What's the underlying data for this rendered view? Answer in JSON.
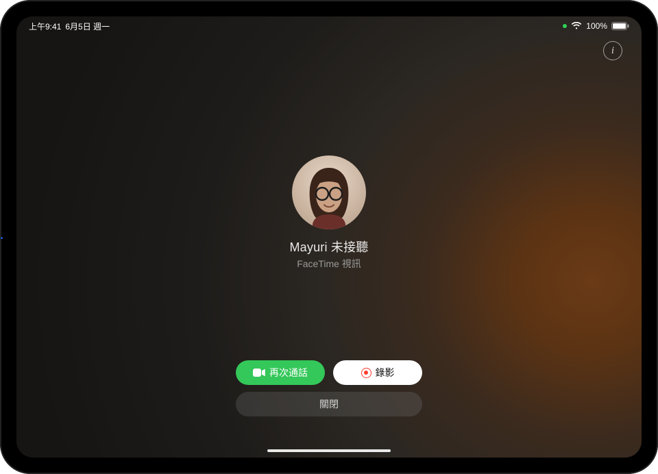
{
  "statusBar": {
    "time": "上午9:41",
    "date": "6月5日 週一",
    "batteryText": "100%"
  },
  "call": {
    "title": "Mayuri 未接聽",
    "subtitle": "FaceTime 視訊"
  },
  "buttons": {
    "callAgain": "再次通話",
    "record": "錄影",
    "close": "關閉"
  },
  "info": {
    "label": "i"
  },
  "colors": {
    "green": "#34c759",
    "red": "#ff3b30"
  }
}
